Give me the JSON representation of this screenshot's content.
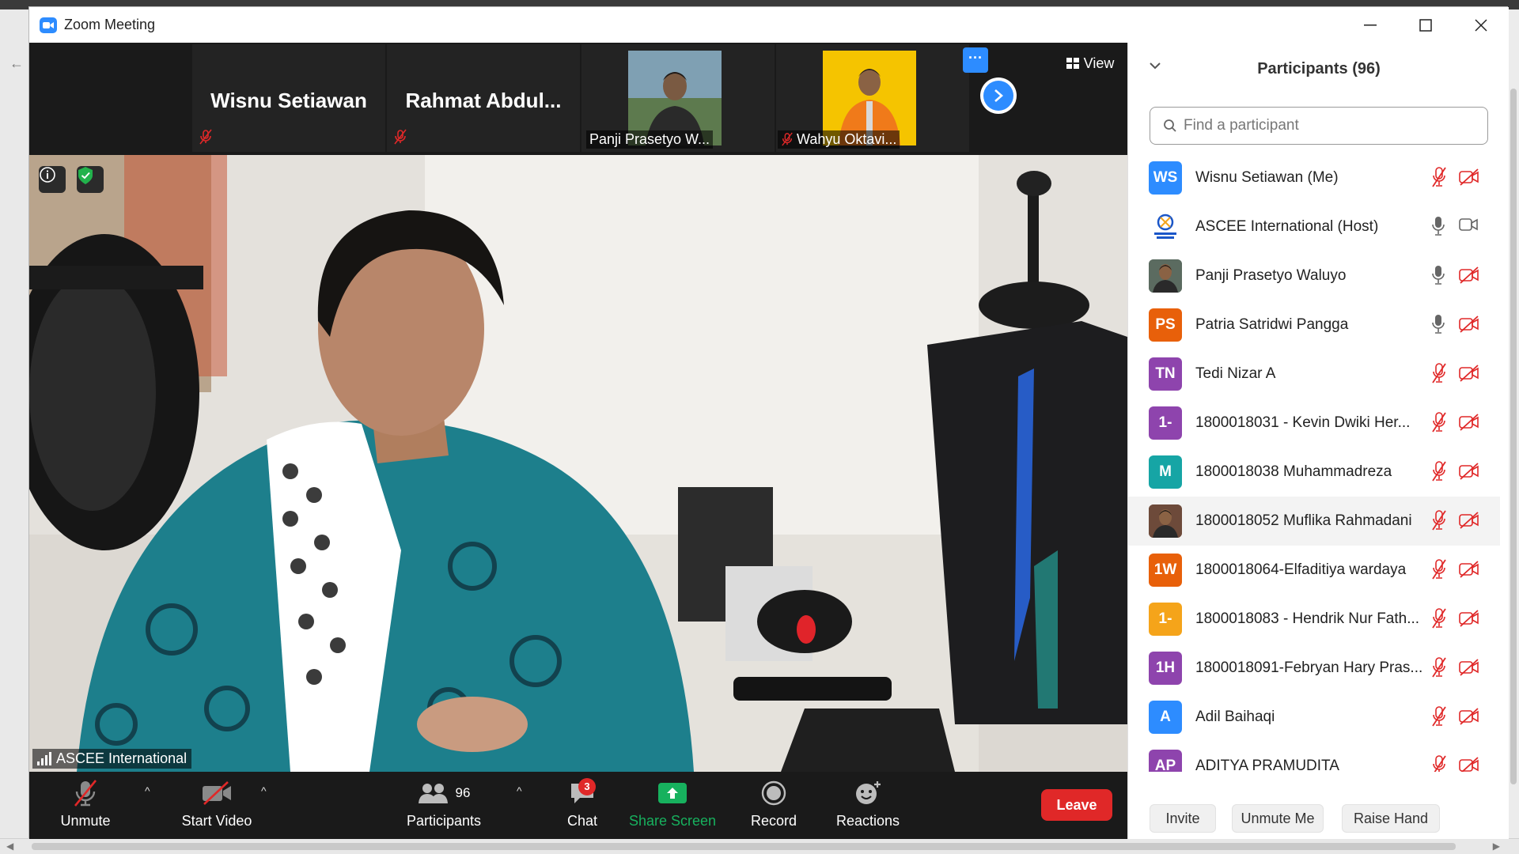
{
  "window": {
    "title": "Zoom Meeting",
    "minimize": "—",
    "maximize": "☐",
    "close": "✕"
  },
  "strip": {
    "tiles": [
      {
        "name": "Wisnu Setiawan"
      },
      {
        "name": "Rahmat  Abdul..."
      },
      {
        "name": "Panji Prasetyo W..."
      },
      {
        "name": "Wahyu Oktavi..."
      }
    ],
    "more": "···",
    "view": "View"
  },
  "main_video": {
    "speaker": "ASCEE International"
  },
  "toolbar": {
    "unmute": "Unmute",
    "start_video": "Start Video",
    "participants": "Participants",
    "participants_count": "96",
    "chat": "Chat",
    "chat_badge": "3",
    "share_screen": "Share Screen",
    "record": "Record",
    "reactions": "Reactions",
    "leave": "Leave"
  },
  "panel": {
    "title": "Participants (96)",
    "search_placeholder": "Find a participant",
    "participants": [
      {
        "initials": "WS",
        "name": "Wisnu Setiawan (Me)",
        "color": "#2d8cff",
        "mic": "muted",
        "cam": "off"
      },
      {
        "initials": "",
        "name": "ASCEE International (Host)",
        "color": "#ffffff",
        "mic": "on",
        "cam": "on",
        "avatar": "logo"
      },
      {
        "initials": "",
        "name": "Panji Prasetyo Waluyo",
        "color": "#5b6b60",
        "mic": "on",
        "cam": "off",
        "avatar": "photo"
      },
      {
        "initials": "PS",
        "name": "Patria Satridwi Pangga",
        "color": "#e8600a",
        "mic": "on",
        "cam": "off"
      },
      {
        "initials": "TN",
        "name": " Tedi Nizar A",
        "color": "#8e44ad",
        "mic": "muted",
        "cam": "off"
      },
      {
        "initials": "1-",
        "name": "1800018031 - Kevin Dwiki Her...",
        "color": "#8e44ad",
        "mic": "muted",
        "cam": "off"
      },
      {
        "initials": "M",
        "name": "1800018038 Muhammadreza",
        "color": "#16a5a5",
        "mic": "muted",
        "cam": "off"
      },
      {
        "initials": "",
        "name": "1800018052 Muflika Rahmadani",
        "color": "#6d4a3a",
        "mic": "muted",
        "cam": "off",
        "avatar": "photo"
      },
      {
        "initials": "1W",
        "name": "1800018064-Elfaditiya wardaya",
        "color": "#e8600a",
        "mic": "muted",
        "cam": "off"
      },
      {
        "initials": "1-",
        "name": "1800018083 - Hendrik Nur Fath...",
        "color": "#f5a41a",
        "mic": "muted",
        "cam": "off"
      },
      {
        "initials": "1H",
        "name": "1800018091-Febryan Hary Pras...",
        "color": "#8e44ad",
        "mic": "muted",
        "cam": "off"
      },
      {
        "initials": "A",
        "name": "Adil Baihaqi",
        "color": "#2d8cff",
        "mic": "muted",
        "cam": "off"
      },
      {
        "initials": "AP",
        "name": "ADITYA PRAMUDITA",
        "color": "#8e44ad",
        "mic": "muted",
        "cam": "off"
      }
    ],
    "invite": "Invite",
    "unmute_me": "Unmute Me",
    "raise_hand": "Raise Hand"
  },
  "colors": {
    "accent": "#2d8cff",
    "danger": "#e02828",
    "share": "#17b15e",
    "muted_icon": "#e02828"
  }
}
